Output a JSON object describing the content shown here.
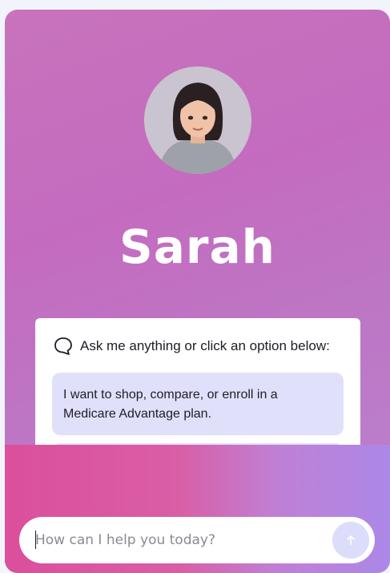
{
  "assistant": {
    "name": "Sarah"
  },
  "panel": {
    "prompt": "Ask me anything or click an option below:",
    "options": [
      {
        "label": "I want to shop, compare, or enroll in a Medicare Advantage plan."
      },
      {
        "label": ""
      }
    ]
  },
  "input": {
    "placeholder": "How can I help you today?",
    "value": ""
  },
  "icons": {
    "prompt": "chat-bubble-icon",
    "send": "arrow-up-icon",
    "avatar": "avatar-portrait"
  },
  "colors": {
    "header_gradient_start": "#c873bb",
    "header_gradient_end": "#b983cf",
    "bottom_gradient_start": "#db4f9c",
    "bottom_gradient_end": "#ac88e8",
    "option_background": "#e1e0fb",
    "send_button": "#dcdcfb",
    "name_text": "#ffffff"
  }
}
